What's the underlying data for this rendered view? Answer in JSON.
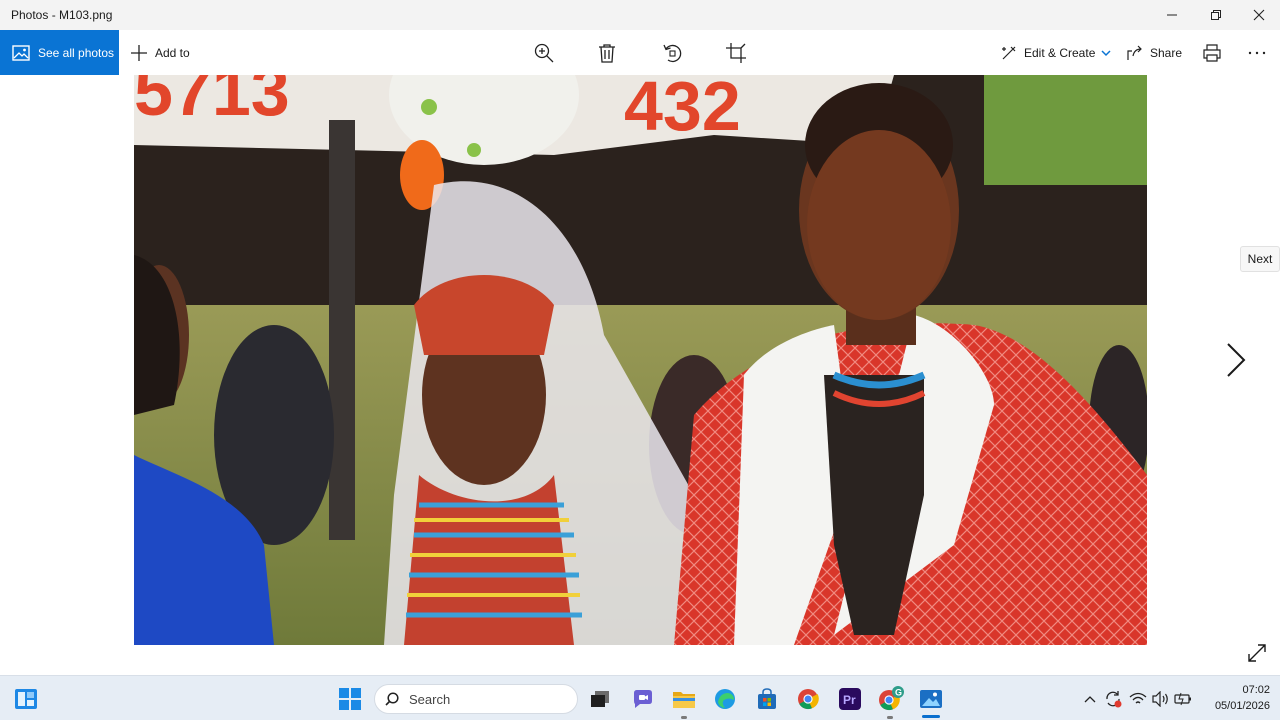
{
  "window": {
    "title": "Photos - M103.png",
    "minimize_icon": "minimize-icon",
    "maximize_icon": "restore-icon",
    "close_icon": "close-icon"
  },
  "toolbar": {
    "see_all_photos": "See all photos",
    "add_to": "Add to",
    "actions": [
      "zoom-in-icon",
      "delete-icon",
      "rotate-icon",
      "crop-icon"
    ],
    "edit_create": "Edit & Create",
    "share": "Share",
    "print_icon": "print-icon",
    "more_icon": "more-icon",
    "accent_color": "#0a74d4"
  },
  "viewer": {
    "next_tooltip": "Next",
    "next_icon": "chevron-right-icon",
    "expand_icon": "expand-icon",
    "photo_description_icon": "photo-wedding"
  },
  "taskbar": {
    "search_placeholder": "Search",
    "pinned": [
      "start-icon",
      "search-icon",
      "task-view-icon",
      "chat-icon",
      "file-explorer-icon",
      "edge-icon",
      "store-icon",
      "chrome-icon",
      "premiere-icon",
      "chrome-profile-icon",
      "photos-icon"
    ],
    "premiere_label": "Pr",
    "profile_badge": "G",
    "tray": [
      "chevron-up-icon",
      "sync-icon",
      "wifi-icon",
      "volume-icon",
      "battery-icon"
    ],
    "time": "07:02",
    "date": "05/01/2026"
  }
}
